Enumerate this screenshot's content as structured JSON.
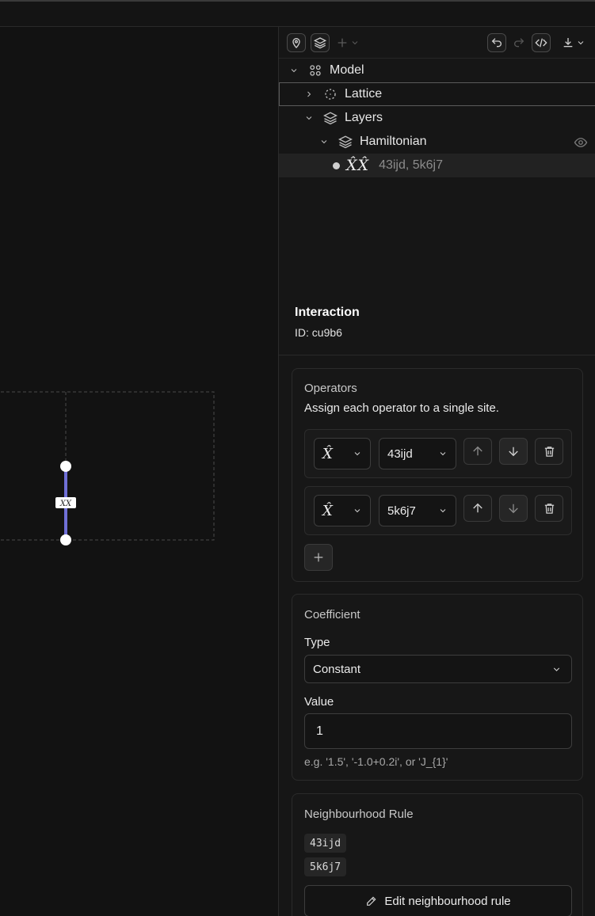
{
  "tree": {
    "model_label": "Model",
    "lattice_label": "Lattice",
    "layers_label": "Layers",
    "hamiltonian_label": "Hamiltonian",
    "interaction_symbol": "X̂X̂",
    "interaction_sites": "43ijd, 5k6j7"
  },
  "canvas": {
    "bond_label": "XX"
  },
  "details": {
    "title": "Interaction",
    "id_text": "ID: cu9b6"
  },
  "operators": {
    "title": "Operators",
    "description": "Assign each operator to a single site.",
    "rows": [
      {
        "operator": "X̂",
        "site": "43ijd"
      },
      {
        "operator": "X̂",
        "site": "5k6j7"
      }
    ]
  },
  "coefficient": {
    "title": "Coefficient",
    "type_label": "Type",
    "type_value": "Constant",
    "value_label": "Value",
    "value": "1",
    "hint": "e.g. '1.5', '-1.0+0.2i', or 'J_{1}'"
  },
  "neighbourhood": {
    "title": "Neighbourhood Rule",
    "sites": [
      "43ijd",
      "5k6j7"
    ],
    "edit_label": "Edit neighbourhood rule"
  },
  "colors": {
    "bond": "#6f6fd6",
    "background": "#121212",
    "panel": "#161616"
  },
  "icons": {
    "toolbar": [
      "pin-icon",
      "layers-icon",
      "plus-icon",
      "undo-icon",
      "redo-icon",
      "code-icon",
      "download-icon"
    ],
    "operator_row": [
      "arrow-up-icon",
      "arrow-down-icon",
      "trash-icon"
    ]
  }
}
